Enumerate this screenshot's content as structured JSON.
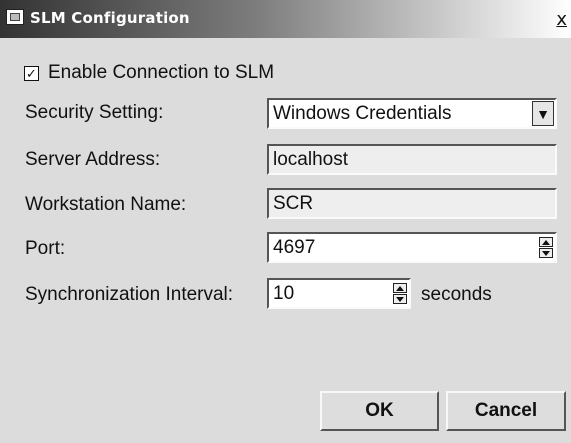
{
  "window": {
    "title": "SLM Configuration",
    "close_glyph": "x",
    "icon": "app-icon"
  },
  "enable_connection": {
    "label": "Enable Connection to SLM",
    "checked": true,
    "check_glyph": "✓"
  },
  "security": {
    "label": "Security Setting:",
    "value": "Windows Credentials",
    "arrow_glyph": "▼"
  },
  "server": {
    "label": "Server Address:",
    "value": "localhost"
  },
  "workstation": {
    "label": "Workstation Name:",
    "value": "SCR"
  },
  "port": {
    "label": "Port:",
    "value": "4697"
  },
  "sync": {
    "label": "Synchronization Interval:",
    "value": "10",
    "unit": "seconds"
  },
  "buttons": {
    "ok": "OK",
    "cancel": "Cancel"
  }
}
